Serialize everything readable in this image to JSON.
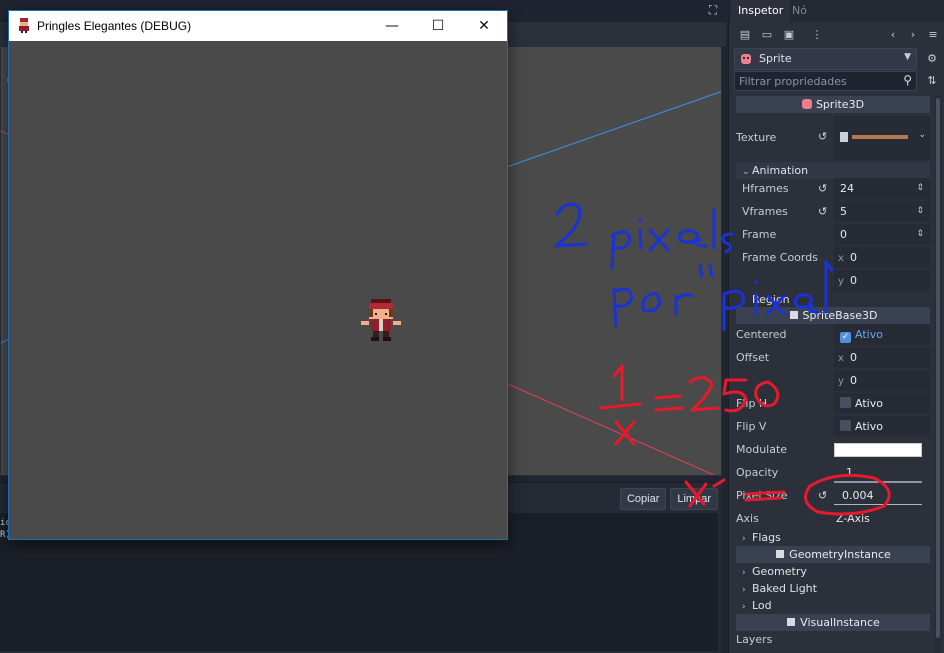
{
  "game_window": {
    "title": "Pringles Elegantes (DEBUG)",
    "minimize_glyph": "—",
    "maximize_glyph": "☐",
    "close_glyph": "✕"
  },
  "editor": {
    "output_buttons": {
      "copy": "Copiar",
      "clear": "Limpar"
    },
    "output_lines": [
      "ic",
      "R) UHD Graphics 620"
    ]
  },
  "inspector": {
    "tabs": {
      "inspector": "Inspetor",
      "node": "Nó"
    },
    "object_name": "Sprite",
    "filter_placeholder": "Filtrar propriedades",
    "sections": {
      "sprite3d": "Sprite3D",
      "spritebase3d": "SpriteBase3D",
      "geometry_instance": "GeometryInstance",
      "visual_instance": "VisualInstance"
    },
    "props": {
      "texture": "Texture",
      "animation": "Animation",
      "hframes": {
        "label": "Hframes",
        "value": "24"
      },
      "vframes": {
        "label": "Vframes",
        "value": "5"
      },
      "frame": {
        "label": "Frame",
        "value": "0"
      },
      "frame_coords": {
        "label": "Frame Coords",
        "x": "0",
        "y": "0"
      },
      "region": "Region",
      "centered": {
        "label": "Centered",
        "value": "Ativo",
        "checked": true
      },
      "offset": {
        "label": "Offset",
        "x": "0",
        "y": "0"
      },
      "flip_h": {
        "label": "Flip H",
        "value": "Ativo",
        "checked": false
      },
      "flip_v": {
        "label": "Flip V",
        "value": "Ativo",
        "checked": false
      },
      "modulate": {
        "label": "Modulate",
        "color": "#ffffff"
      },
      "opacity": {
        "label": "Opacity",
        "value": "1"
      },
      "pixel_size": {
        "label": "Pixel Size",
        "value": "0.004"
      },
      "axis": {
        "label": "Axis",
        "value": "Z-Axis"
      },
      "flags": "Flags",
      "geometry": "Geometry",
      "baked_light": "Baked Light",
      "lod": "Lod",
      "layers": "Layers"
    },
    "axis_letters": {
      "x": "x",
      "y": "y"
    }
  },
  "annotations": {
    "blue_text_line1": "2 pixels",
    "blue_text_line2": "por\"pixel\"",
    "red_equation": "1/x = 250",
    "ink_colors": {
      "blue": "#1a33d6",
      "red": "#e8192c"
    }
  },
  "colors": {
    "accent": "#4f8fe0",
    "viewport_bg": "#4a4a4a",
    "dock_bg": "#2b303b",
    "section_bg": "#3a4150"
  }
}
